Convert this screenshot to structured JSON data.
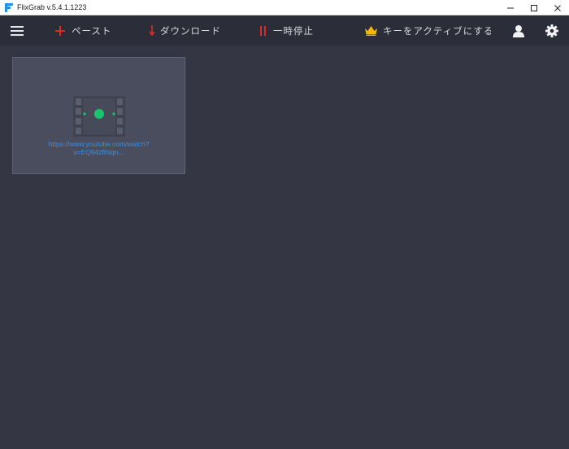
{
  "window": {
    "title": "FlixGrab  v.5.4.1.1223"
  },
  "toolbar": {
    "paste_label": "ペースト",
    "download_label": "ダウンロード",
    "pause_label": "一時停止",
    "activate_label": "キーをアクティブにする"
  },
  "card": {
    "url_line1": "https://www.youtube.com/watch?",
    "url_line2": "v=EQ94zflNqn..."
  },
  "colors": {
    "background": "#343743",
    "toolbar": "#2b2e38",
    "card": "#4a4d5d",
    "accent_red": "#e02a2a",
    "accent_green": "#19c46c",
    "crown_gold": "#f5b800",
    "link_blue": "#3c8ee3"
  }
}
